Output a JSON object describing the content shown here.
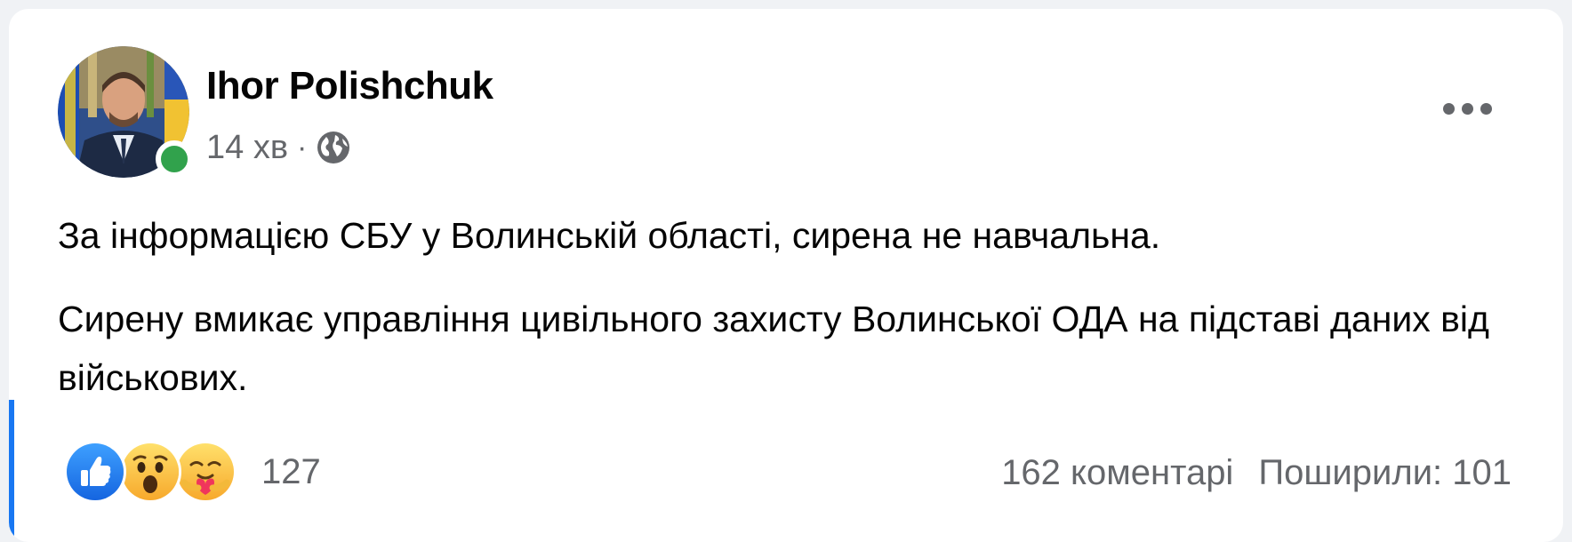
{
  "post": {
    "author": "Ihor Polishchuk",
    "time": "14 хв",
    "separator": "·",
    "visibility_icon": "globe-icon",
    "paragraphs": [
      "За інформацією СБУ у Волинській області, сирена не навчальна.",
      "Сирену вмикає управління цивільного захисту Волинської ОДА на підставі даних від військових."
    ],
    "reactions": {
      "icons": [
        "like-icon",
        "wow-icon",
        "care-icon"
      ],
      "count": "127"
    },
    "comments": "162 коментарі",
    "shares": "Поширили: 101"
  },
  "colors": {
    "online": "#31a24c",
    "like_blue": "#1877f2",
    "secondary_text": "#65676b",
    "accent": "#1877f2"
  }
}
